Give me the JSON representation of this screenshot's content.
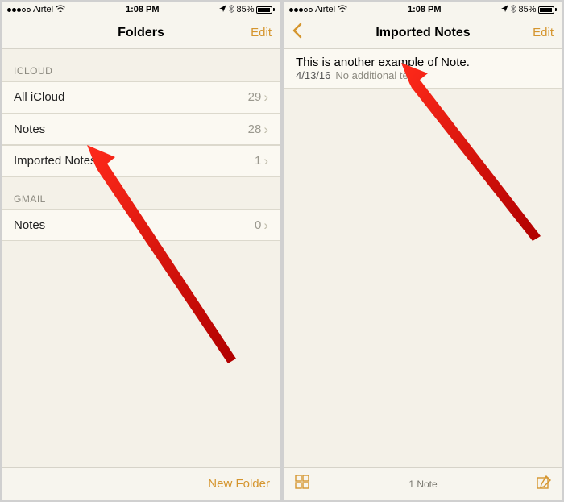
{
  "status_bar": {
    "carrier": "Airtel",
    "time": "1:08 PM",
    "battery_percent": "85%"
  },
  "left_screen": {
    "title": "Folders",
    "edit_label": "Edit",
    "sections": {
      "icloud": {
        "header": "ICLOUD",
        "rows": [
          {
            "label": "All iCloud",
            "count": "29"
          },
          {
            "label": "Notes",
            "count": "28"
          },
          {
            "label": "Imported Notes",
            "count": "1"
          }
        ]
      },
      "gmail": {
        "header": "GMAIL",
        "rows": [
          {
            "label": "Notes",
            "count": "0"
          }
        ]
      }
    },
    "bottom": {
      "new_folder_label": "New Folder"
    }
  },
  "right_screen": {
    "title": "Imported Notes",
    "edit_label": "Edit",
    "notes": [
      {
        "title": "This is another example of Note.",
        "date": "4/13/16",
        "preview": "No additional text"
      }
    ],
    "bottom": {
      "count_label": "1 Note"
    }
  }
}
